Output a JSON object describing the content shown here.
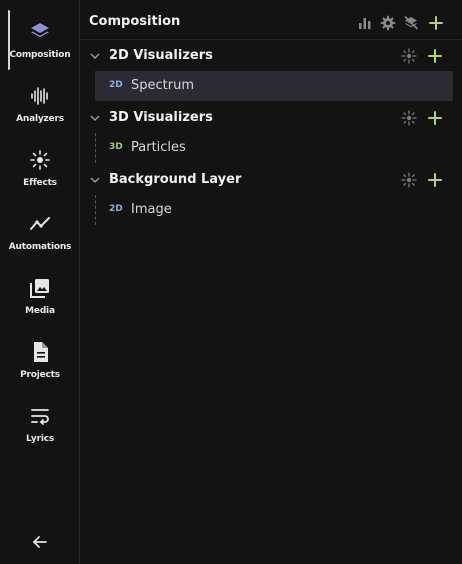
{
  "sidebar": {
    "items": [
      {
        "label": "Composition",
        "icon": "layers-icon",
        "active": true
      },
      {
        "label": "Analyzers",
        "icon": "waveform-icon"
      },
      {
        "label": "Effects",
        "icon": "sparkle-icon"
      },
      {
        "label": "Automations",
        "icon": "trend-line-icon"
      },
      {
        "label": "Media",
        "icon": "photo-library-icon"
      },
      {
        "label": "Projects",
        "icon": "document-icon"
      },
      {
        "label": "Lyrics",
        "icon": "text-wrap-icon"
      }
    ],
    "back_icon": "arrow-left-icon"
  },
  "header": {
    "title": "Composition",
    "actions": [
      "bar-chart-icon",
      "gear-icon",
      "layers-off-icon",
      "plus-icon"
    ]
  },
  "groups": [
    {
      "title": "2D Visualizers",
      "items": [
        {
          "badge": "2D",
          "label": "Spectrum",
          "selected": true
        }
      ]
    },
    {
      "title": "3D Visualizers",
      "items": [
        {
          "badge": "3D",
          "label": "Particles"
        }
      ]
    },
    {
      "title": "Background Layer",
      "items": [
        {
          "badge": "2D",
          "label": "Image"
        }
      ]
    }
  ],
  "colors": {
    "accent_green": "#b5d46a",
    "badge_2d": "#7fb3e6",
    "badge_3d": "#a6c86a",
    "selected_row": "#2b2b31",
    "background": "#131313"
  }
}
